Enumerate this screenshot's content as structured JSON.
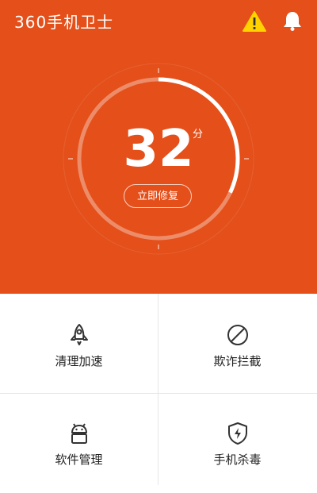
{
  "header": {
    "app_title": "360手机卫士",
    "warning_icon": "warning-triangle-icon",
    "bell_icon": "bell-icon",
    "background_color": "#e44f1a",
    "warning_color": "#ffd200"
  },
  "score": {
    "value": "32",
    "unit": "分",
    "progress_fraction": 0.32,
    "repair_label": "立即修复"
  },
  "tiles": [
    {
      "label": "清理加速",
      "icon": "rocket-icon"
    },
    {
      "label": "欺诈拦截",
      "icon": "block-icon"
    },
    {
      "label": "软件管理",
      "icon": "android-icon"
    },
    {
      "label": "手机杀毒",
      "icon": "shield-bolt-icon"
    }
  ]
}
